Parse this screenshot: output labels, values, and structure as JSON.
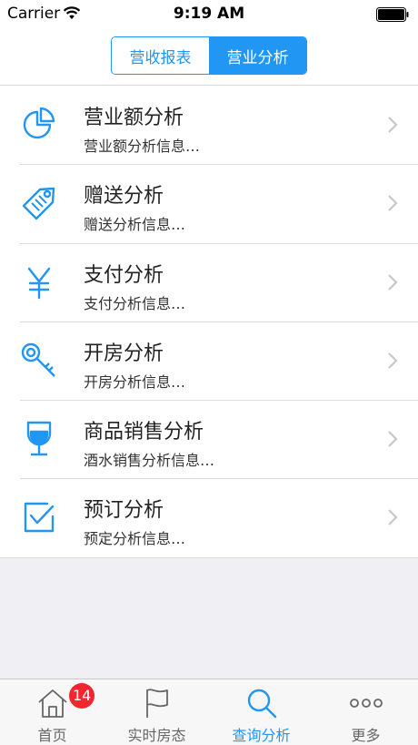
{
  "status_bar": {
    "carrier": "Carrier",
    "time": "9:19 AM"
  },
  "segmented": {
    "tabs": [
      "营收报表",
      "营业分析"
    ],
    "selected": 1
  },
  "list": [
    {
      "icon": "pie-chart-icon",
      "title": "营业额分析",
      "subtitle": "营业额分析信息…"
    },
    {
      "icon": "tag-icon",
      "title": "赠送分析",
      "subtitle": "赠送分析信息…"
    },
    {
      "icon": "yen-icon",
      "title": "支付分析",
      "subtitle": "支付分析信息…"
    },
    {
      "icon": "key-icon",
      "title": "开房分析",
      "subtitle": "开房分析信息…"
    },
    {
      "icon": "wine-glass-icon",
      "title": "商品销售分析",
      "subtitle": "酒水销售分析信息…"
    },
    {
      "icon": "checkbox-icon",
      "title": "预订分析",
      "subtitle": "预定分析信息…"
    }
  ],
  "tabbar": {
    "items": [
      {
        "label": "首页",
        "icon": "home-icon",
        "badge": "14"
      },
      {
        "label": "实时房态",
        "icon": "flag-icon"
      },
      {
        "label": "查询分析",
        "icon": "search-icon",
        "active": true
      },
      {
        "label": "更多",
        "icon": "more-icon"
      }
    ]
  },
  "colors": {
    "accent": "#2196f3",
    "badge": "#f2262c",
    "background": "#efeff4"
  }
}
